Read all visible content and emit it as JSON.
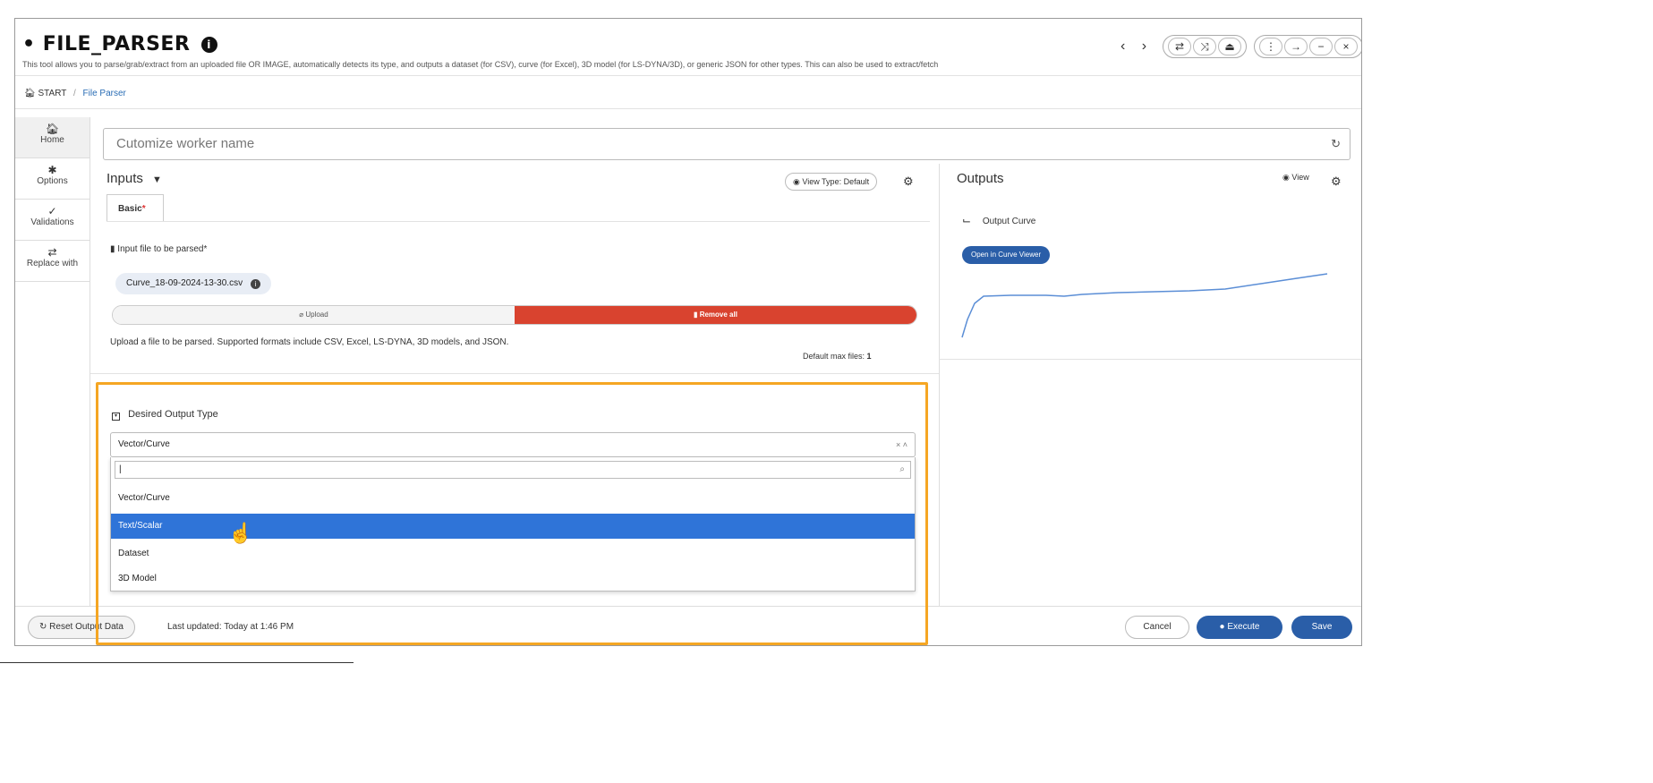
{
  "header": {
    "title_prefix": "•",
    "title": "FILE_PARSER",
    "info_glyph": "i",
    "subtitle": "This tool allows you to parse/grab/extract from an uploaded file OR IMAGE, automatically detects its type, and outputs a dataset (for CSV), curve (for Excel), 3D model (for LS-DYNA/3D), or generic JSON for other types. This can also be used to extract/fetch",
    "nav_back": "‹",
    "nav_forward": "›",
    "tools_a": [
      "⇄",
      "⤨",
      "⏏"
    ],
    "tools_b": [
      "⋮",
      "→",
      "−",
      "×"
    ]
  },
  "breadcrumb": {
    "home": "START",
    "separator": "/",
    "current": "File Parser"
  },
  "sidebar": {
    "items": [
      {
        "icon": "home-icon",
        "glyph": "🏠︎",
        "label": "Home"
      },
      {
        "icon": "gear-icon",
        "glyph": "✱",
        "label": "Options"
      },
      {
        "icon": "check-icon",
        "glyph": "✓",
        "label": "Validations"
      },
      {
        "icon": "swap-icon",
        "glyph": "⇄",
        "label": "Replace with"
      }
    ]
  },
  "worker": {
    "placeholder": "Cutomize worker name",
    "value": ""
  },
  "inputs": {
    "title": "Inputs",
    "caret": "▼",
    "view_type": "View Type: Default",
    "tab": "Basic",
    "required_mark": "*",
    "file_label": "Input file to be parsed",
    "file_chip": "Curve_18-09-2024-13-30.csv",
    "upload_label": "Upload",
    "remove_label": "Remove all",
    "help_text": "Upload a file to be parsed. Supported formats include CSV, Excel, LS-DYNA, 3D models, and JSON.",
    "max_files_label": "Default max files:",
    "max_files_value": "1"
  },
  "desired_output": {
    "label": "Desired Output Type",
    "selected": "Vector/Curve",
    "controls": "× ˄",
    "search_value": "|",
    "options": [
      "Vector/Curve",
      "Text/Scalar",
      "Dataset",
      "3D Model"
    ],
    "highlighted_index": 1
  },
  "outputs": {
    "title": "Outputs",
    "view_label": "View",
    "curve_label": "Output Curve",
    "curve_viewer_button": "Open in Curve Viewer",
    "curve_color": "#5b8ed6"
  },
  "bottom": {
    "reset_label": "Reset Output Data",
    "last_updated": "Last updated: Today at 1:46 PM",
    "cancel": "Cancel",
    "execute": "Execute",
    "save": "Save"
  },
  "colors": {
    "accent": "#2a5ea8",
    "highlight_option": "#2f74d8",
    "remove_button": "#d9432f",
    "annotation_box": "#f5a623"
  }
}
